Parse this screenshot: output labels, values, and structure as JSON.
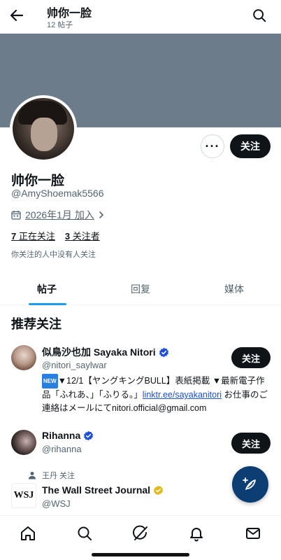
{
  "header": {
    "title": "帅你一脸",
    "subtitle": "12 帖子"
  },
  "profile": {
    "name": "帅你一脸",
    "handle": "@AmyShoemak5566",
    "joined": "2026年1月 加入",
    "following_count": "7",
    "following_label": "正在关注",
    "followers_count": "3",
    "followers_label": "关注者",
    "mutual_note": "你关注的人中没有人关注",
    "follow_button": "关注",
    "more_label": "···"
  },
  "tabs": [
    {
      "label": "帖子"
    },
    {
      "label": "回复"
    },
    {
      "label": "媒体"
    }
  ],
  "suggestions": {
    "title": "推荐关注",
    "items": [
      {
        "name": "似鳥沙也加 Sayaka Nitori",
        "handle": "@nitori_saylwar",
        "follow": "关注",
        "bio_badge": "NEW",
        "bio_pre": "▼12/1【ヤングキングBULL】表紙掲載 ▼最新電子作品「ふれあ、」「ふりる。」",
        "bio_link": "linktr.ee/sayakanitori",
        "bio_post": " お仕事のご連絡はメールにてnitori.official@gmail.com"
      },
      {
        "name": "Rihanna",
        "handle": "@rihanna",
        "follow": "关注"
      },
      {
        "context": "王丹 关注",
        "logo_text": "WSJ",
        "name": "The Wall Street Journal",
        "handle": "@WSJ"
      }
    ]
  },
  "colors": {
    "accent": "#1d9bf0",
    "banner": "#6c7c8b",
    "verified_blue": "#1d4ed8",
    "verified_gold": "#e2b719",
    "fab": "#0c3d73"
  }
}
